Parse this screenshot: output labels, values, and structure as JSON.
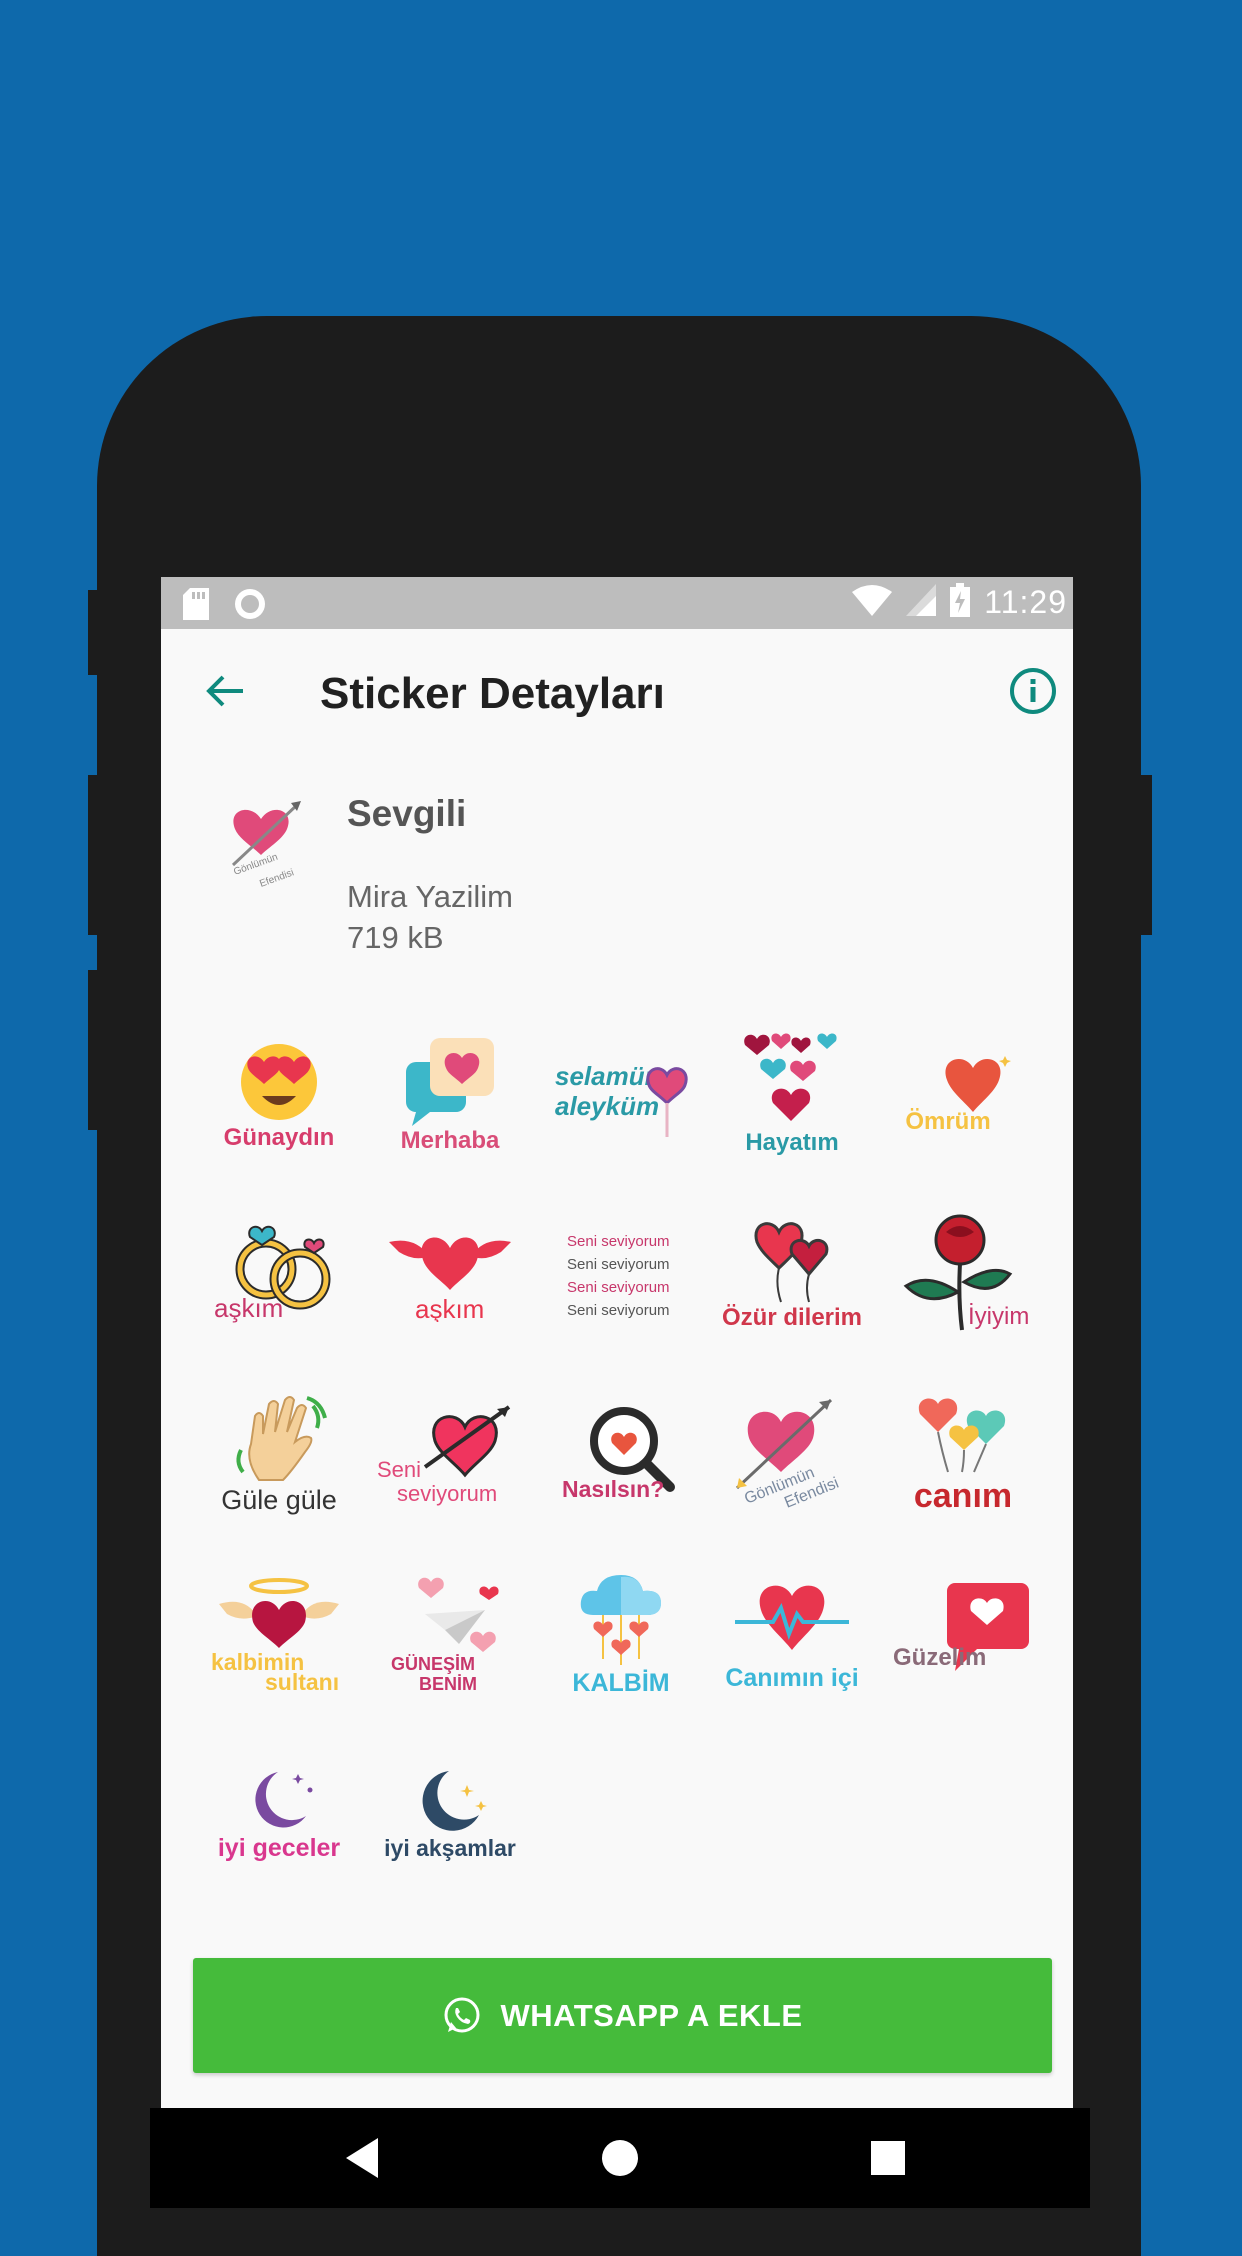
{
  "status_bar": {
    "time": "11:29"
  },
  "toolbar": {
    "title": "Sticker Detayları"
  },
  "pack": {
    "name": "Sevgili",
    "publisher": "Mira Yazilim",
    "size": "719 kB",
    "icon_text": "Gönlümün Efendisi"
  },
  "stickers": [
    {
      "label": "Günaydın",
      "icon": "heart-eyes-emoji-icon"
    },
    {
      "label": "Merhaba",
      "icon": "chat-heart-icon"
    },
    {
      "label": "selamün aleyküm",
      "icon": "heart-lollipop-icon"
    },
    {
      "label": "Hayatım",
      "icon": "hearts-icon"
    },
    {
      "label": "Ömrüm",
      "icon": "heart-icon"
    },
    {
      "label": "aşkım",
      "icon": "rings-icon"
    },
    {
      "label": "aşkım",
      "icon": "winged-heart-icon"
    },
    {
      "label": "Seni seviyorum",
      "icon": "text-icon"
    },
    {
      "label": "Özür dilerim",
      "icon": "heart-balloons-icon"
    },
    {
      "label": "İyiyim",
      "icon": "rose-icon"
    },
    {
      "label": "Güle güle",
      "icon": "waving-hand-icon"
    },
    {
      "label": "Seni seviyorum",
      "icon": "arrow-heart-icon"
    },
    {
      "label": "Nasılsın?",
      "icon": "magnifier-heart-icon"
    },
    {
      "label": "Gönlümün Efendisi",
      "icon": "arrow-heart-icon"
    },
    {
      "label": "canım",
      "icon": "balloons-icon"
    },
    {
      "label": "kalbimin sultanı",
      "icon": "angel-heart-icon"
    },
    {
      "label": "GÜNEŞİM BENİM",
      "icon": "paper-plane-icon"
    },
    {
      "label": "KALBİM",
      "icon": "cloud-hearts-icon"
    },
    {
      "label": "Canımın içi",
      "icon": "heartbeat-icon"
    },
    {
      "label": "Güzelim",
      "icon": "heart-bubble-icon"
    },
    {
      "label": "iyi geceler",
      "icon": "moon-icon"
    },
    {
      "label": "iyi akşamlar",
      "icon": "moon-stars-icon"
    }
  ],
  "sticker_text": {
    "line": "Seni seviyorum",
    "line1": "Seni",
    "line2": "seviyorum",
    "kalbimin": "kalbimin",
    "sultani": "sultanı",
    "gunesim": "GÜNEŞİM",
    "benim": "BENİM",
    "selamun": "selamün",
    "aleykum": "aleyküm",
    "gonlumun": "Gönlümün",
    "efendisi": "Efendisi"
  },
  "add_button": {
    "label": "WHATSAPP A EKLE"
  },
  "colors": {
    "background": "#0e69ab",
    "accent": "#0f8a7e",
    "button": "#45bb3b",
    "status_bar": "#bdbdbd"
  }
}
